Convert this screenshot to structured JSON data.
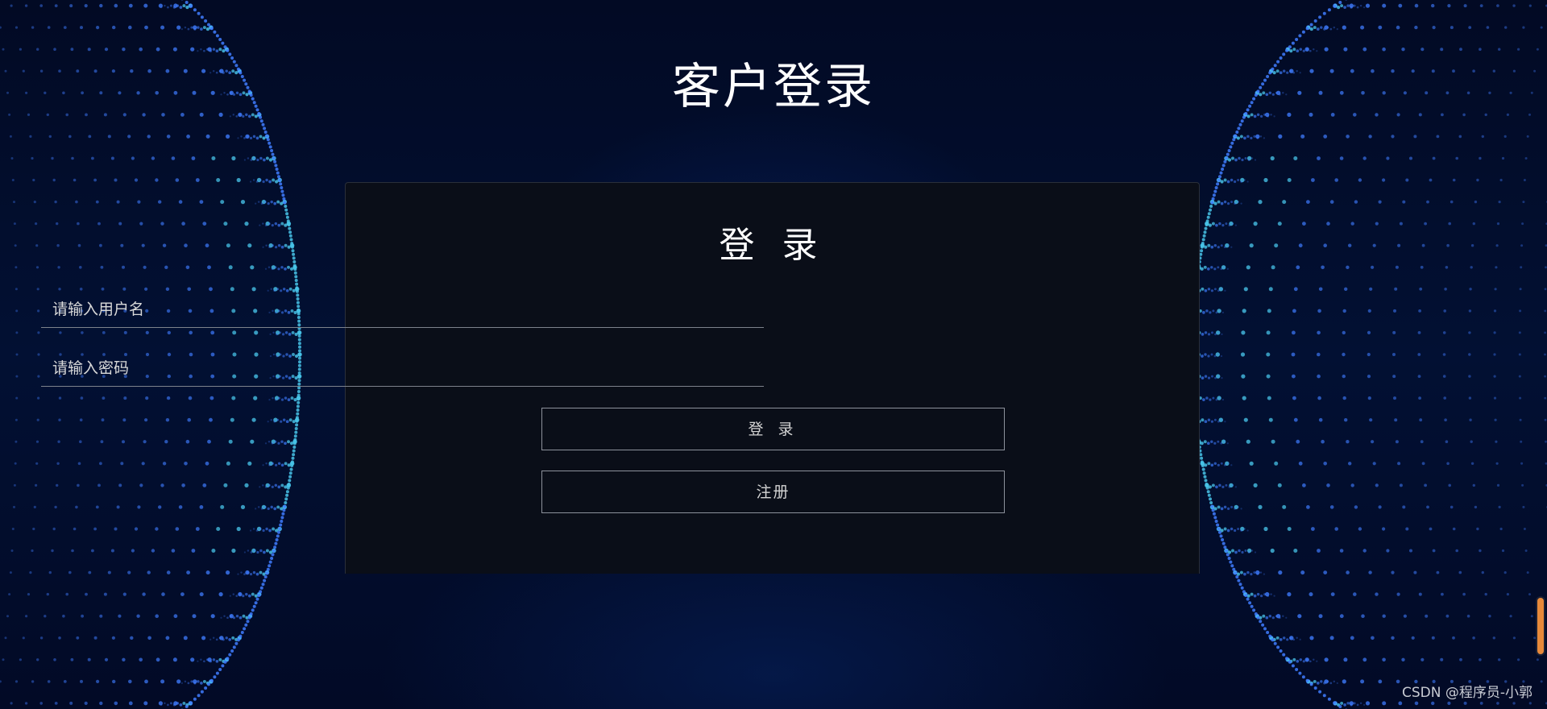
{
  "header": {
    "title": "客户登录"
  },
  "login_card": {
    "title": "登 录",
    "username": {
      "value": "",
      "placeholder": "请输入用户名"
    },
    "password": {
      "value": "",
      "placeholder": "请输入密码"
    },
    "login_button_label": "登 录",
    "register_button_label": "注册"
  },
  "watermark": {
    "text": "CSDN @程序员-小郭"
  },
  "colors": {
    "background": "#02081e",
    "card_background": "#0a0e18",
    "dot_blue": "#3f7cff",
    "dot_cyan": "#48c3e8",
    "scroll_handle": "#e7893a"
  },
  "icons": {
    "background_art": "particle-sphere-dots"
  }
}
